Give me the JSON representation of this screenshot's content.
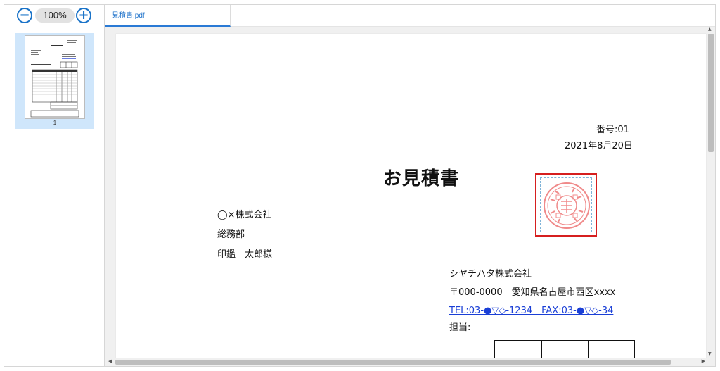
{
  "sidebar": {
    "zoom_out_label": "−",
    "zoom_level": "100%",
    "zoom_in_label": "+",
    "thumbnail": {
      "page_number": "1"
    }
  },
  "tabs": [
    {
      "label": "見積書.pdf",
      "active": true
    }
  ],
  "document": {
    "number": "番号:01",
    "date": "2021年8月20日",
    "title": "お見積書",
    "recipient": {
      "company": "◯×株式会社",
      "department": "総務部",
      "person": "印鑑　太郎様"
    },
    "sender": {
      "company": "シヤチハタ株式会社",
      "address": "〒000-0000　愛知県名古屋市西区xxxx",
      "tel_fax": "TEL:03-●▽◇-1234　FAX:03-●▽◇-34",
      "contact": "担当:"
    }
  },
  "colors": {
    "accent": "#1a73c8",
    "thumbnail_selected": "#cfe6fb",
    "seal_border": "#d61f1f",
    "seal_ink": "#f08a8a",
    "link": "#1a3fd6"
  },
  "icons": {
    "zoom_out": "minus-circle-icon",
    "zoom_in": "plus-circle-icon",
    "seal": "company-seal-icon"
  }
}
